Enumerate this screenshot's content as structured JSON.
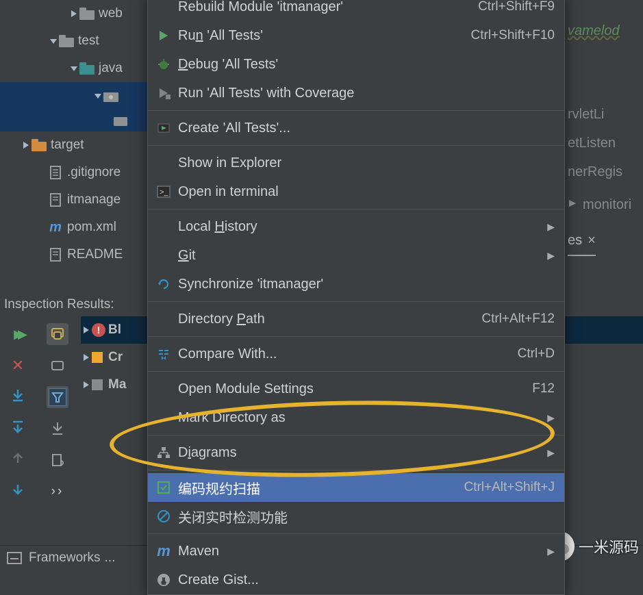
{
  "tree": {
    "web": "web",
    "test": "test",
    "java": "java",
    "target": "target",
    "gitignore": ".gitignore",
    "itmanager": "itmanage",
    "pom": "pom.xml",
    "readme": "README"
  },
  "inspHeader": "Inspection Results:",
  "insp": {
    "blocker": "Bl",
    "cr": "Cr",
    "ma": "Ma"
  },
  "menu": {
    "rebuild": {
      "label": "Rebuild Module 'itmanager'",
      "short": "Ctrl+Shift+F9"
    },
    "run": {
      "label": "Run 'All Tests'",
      "short": "Ctrl+Shift+F10"
    },
    "debug": {
      "label": "Debug 'All Tests'"
    },
    "coverage": {
      "label": "Run 'All Tests' with Coverage"
    },
    "create": {
      "label": "Create 'All Tests'..."
    },
    "explorer": {
      "label": "Show in Explorer"
    },
    "terminal": {
      "label": "Open in terminal"
    },
    "localhist": {
      "label": "Local History"
    },
    "git": {
      "label": "Git"
    },
    "sync": {
      "label": "Synchronize 'itmanager'"
    },
    "dirpath": {
      "label": "Directory Path",
      "short": "Ctrl+Alt+F12"
    },
    "compare": {
      "label": "Compare With...",
      "short": "Ctrl+D"
    },
    "modset": {
      "label": "Open Module Settings",
      "short": "F12"
    },
    "markdir": {
      "label": "Mark Directory as"
    },
    "diagrams": {
      "label": "Diagrams"
    },
    "codescan": {
      "label": "编码规约扫描",
      "short": "Ctrl+Alt+Shift+J"
    },
    "closert": {
      "label": "关闭实时检测功能"
    },
    "maven": {
      "label": "Maven"
    },
    "gist": {
      "label": "Create Gist..."
    }
  },
  "editor": {
    "melody": "vamelod",
    "l1": "rvletLi",
    "l2": "etListen",
    "l3": "nerRegis",
    "l4": "monitori",
    "tab": "es"
  },
  "bottom": {
    "frameworks": "Frameworks",
    "dots": "..."
  },
  "wechat": "一米源码"
}
